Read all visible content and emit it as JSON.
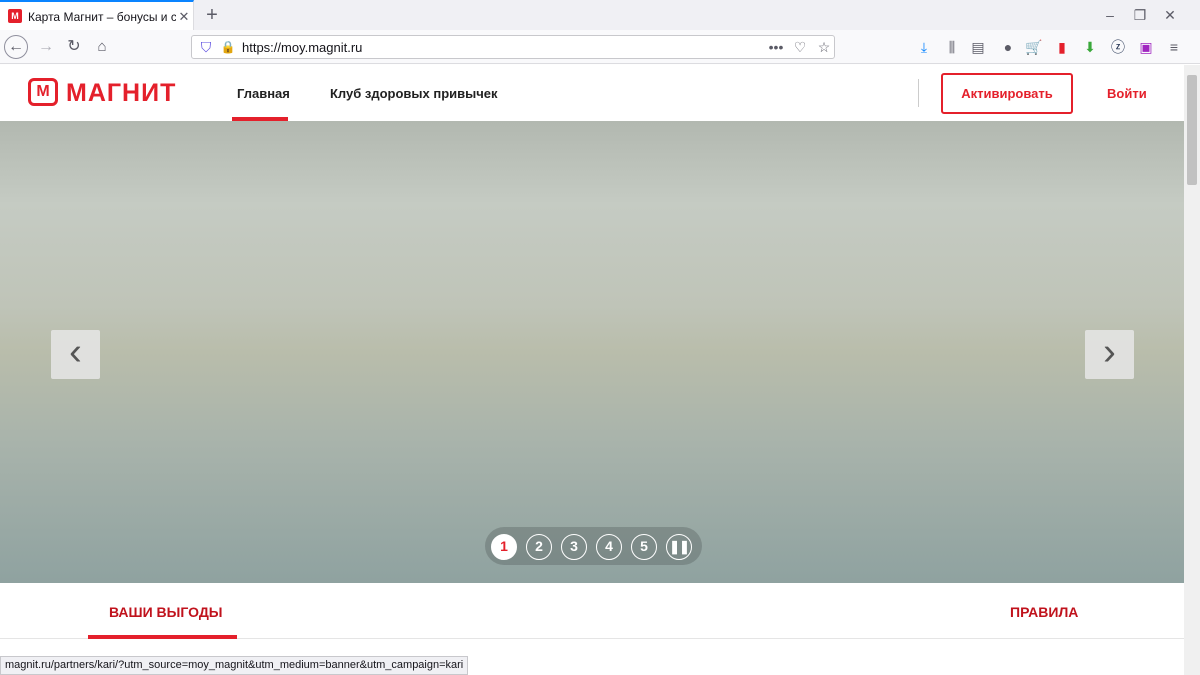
{
  "browser": {
    "tab_title": "Карта Магнит – бонусы и скидки",
    "favicon": "М",
    "url": "https://moy.magnit.ru",
    "status_url": "magnit.ru/partners/kari/?utm_source=moy_magnit&utm_medium=banner&utm_campaign=kari"
  },
  "site": {
    "logo_text": "МАГНИТ",
    "nav": [
      "Главная",
      "Клуб здоровых привычек"
    ],
    "activate": "Активировать",
    "login": "Войти"
  },
  "carousel": {
    "slides": [
      "1",
      "2",
      "3",
      "4",
      "5"
    ],
    "active": 1,
    "prev": "‹",
    "next": "›"
  },
  "tabs": [
    "ВАШИ ВЫГОДЫ",
    "ПРАВИЛА"
  ],
  "colors": {
    "brand": "#e4202b",
    "text": "#212121"
  }
}
